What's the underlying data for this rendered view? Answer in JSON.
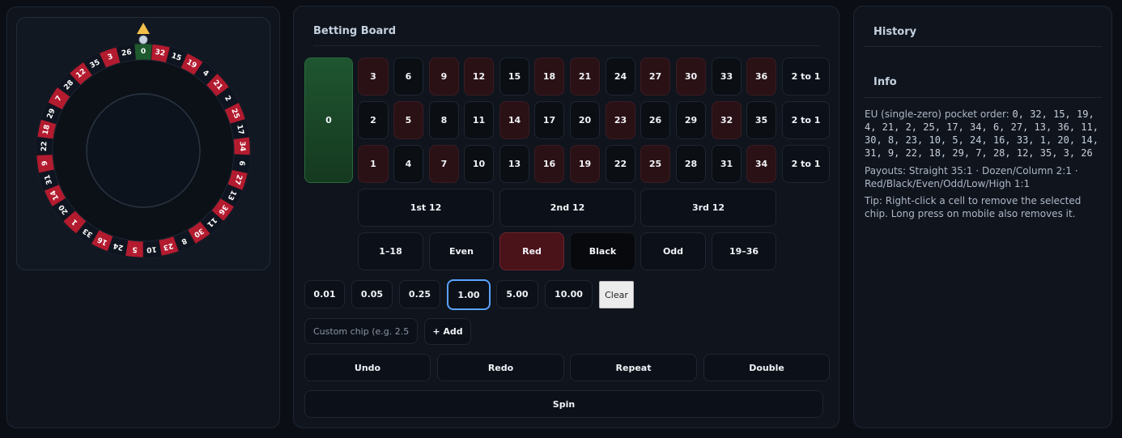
{
  "wheel": {
    "pocket_order": [
      0,
      32,
      15,
      19,
      4,
      21,
      2,
      25,
      17,
      34,
      6,
      27,
      13,
      36,
      11,
      30,
      8,
      23,
      10,
      5,
      24,
      16,
      33,
      1,
      20,
      14,
      31,
      9,
      22,
      18,
      29,
      7,
      28,
      12,
      35,
      3,
      26
    ],
    "red_numbers": [
      1,
      3,
      5,
      7,
      9,
      12,
      14,
      16,
      18,
      19,
      21,
      23,
      25,
      27,
      30,
      32,
      34,
      36
    ],
    "colors": {
      "red": "#b31b2f",
      "black": "#0f1520",
      "green": "#1f5a2e",
      "pointer": "#f2c04a",
      "ball": "#c8d2e0"
    }
  },
  "board": {
    "title": "Betting Board",
    "zero_label": "0",
    "rows": [
      [
        "3",
        "6",
        "9",
        "12",
        "15",
        "18",
        "21",
        "24",
        "27",
        "30",
        "33",
        "36"
      ],
      [
        "2",
        "5",
        "8",
        "11",
        "14",
        "17",
        "20",
        "23",
        "26",
        "29",
        "32",
        "35"
      ],
      [
        "1",
        "4",
        "7",
        "10",
        "13",
        "16",
        "19",
        "22",
        "25",
        "28",
        "31",
        "34"
      ]
    ],
    "column_labels": [
      "2 to 1",
      "2 to 1",
      "2 to 1"
    ],
    "dozens": [
      "1st 12",
      "2nd 12",
      "3rd 12"
    ],
    "outside": [
      "1–18",
      "Even",
      "Red",
      "Black",
      "Odd",
      "19–36"
    ]
  },
  "chips": {
    "values": [
      "0.01",
      "0.05",
      "0.25",
      "1.00",
      "5.00",
      "10.00"
    ],
    "selected": "1.00",
    "clear_label": "Clear",
    "custom_placeholder": "Custom chip (e.g. 2.50",
    "add_label": "+ Add"
  },
  "actions": {
    "undo": "Undo",
    "redo": "Redo",
    "repeat": "Repeat",
    "double": "Double",
    "spin": "Spin"
  },
  "sidebar": {
    "history_title": "History",
    "info_title": "Info",
    "order_prefix": "EU (single-zero) pocket order: ",
    "order_list": "0, 32, 15, 19, 4, 21, 2, 25, 17, 34, 6, 27, 13, 36, 11, 30, 8, 23, 10, 5, 24, 16, 33, 1, 20, 14, 31, 9, 22, 18, 29, 7, 28, 12, 35, 3, 26",
    "payouts": "Payouts: Straight 35:1 · Dozen/Column 2:1 · Red/Black/Even/Odd/Low/High 1:1",
    "tip": "Tip: Right-click a cell to remove the selected chip. Long press on mobile also removes it."
  }
}
